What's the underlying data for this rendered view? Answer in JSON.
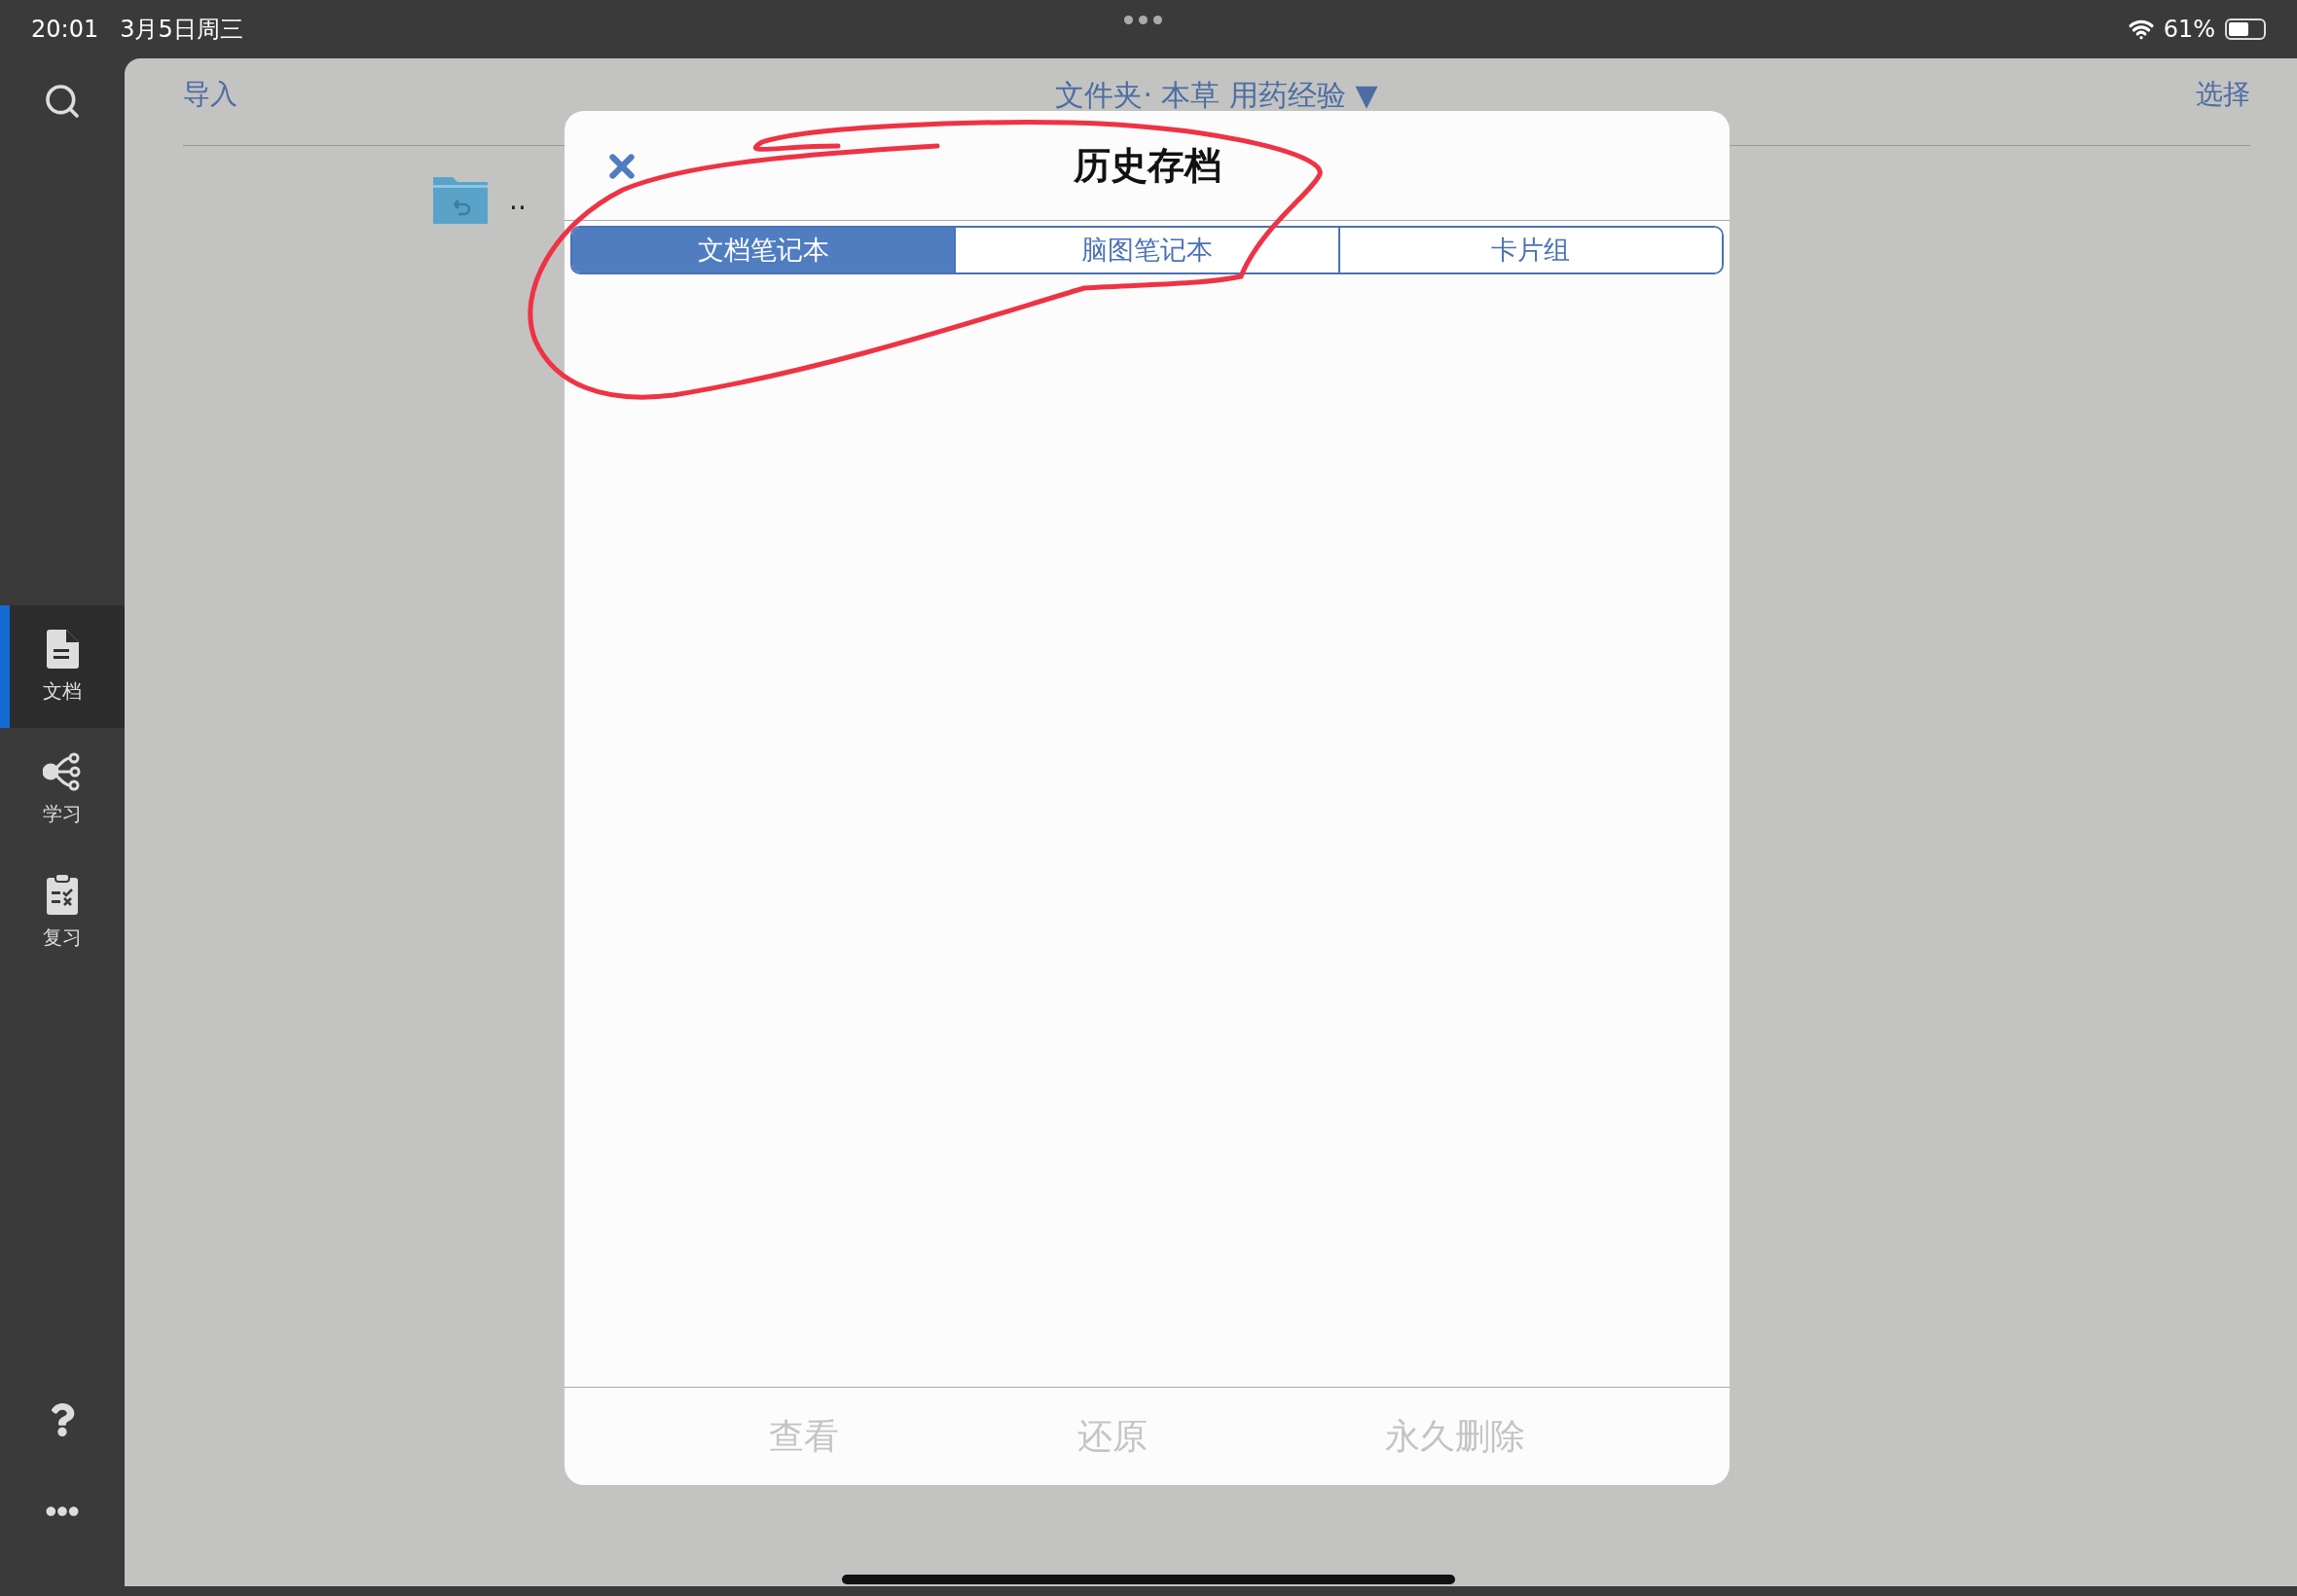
{
  "status_bar": {
    "time": "20:01",
    "date": "3月5日周三",
    "battery": "61%"
  },
  "sidebar": {
    "items": [
      {
        "kind": "document",
        "label": "文档",
        "selected": true
      },
      {
        "kind": "nodes",
        "label": "学习",
        "selected": false
      },
      {
        "kind": "clipboard",
        "label": "复习",
        "selected": false
      }
    ]
  },
  "header": {
    "import": "导入",
    "title": "文件夹· 本草 用药经验 ▼",
    "select": "选择"
  },
  "folder": {
    "name": ".."
  },
  "dialog": {
    "title": "历史存档",
    "tabs": [
      {
        "label": "文档笔记本",
        "selected": true
      },
      {
        "label": "脑图笔记本",
        "selected": false
      },
      {
        "label": "卡片组",
        "selected": false
      }
    ],
    "actions": [
      {
        "label": "查看",
        "disabled": true
      },
      {
        "label": "还原",
        "disabled": true
      },
      {
        "label": "永久删除",
        "disabled": true
      }
    ]
  }
}
